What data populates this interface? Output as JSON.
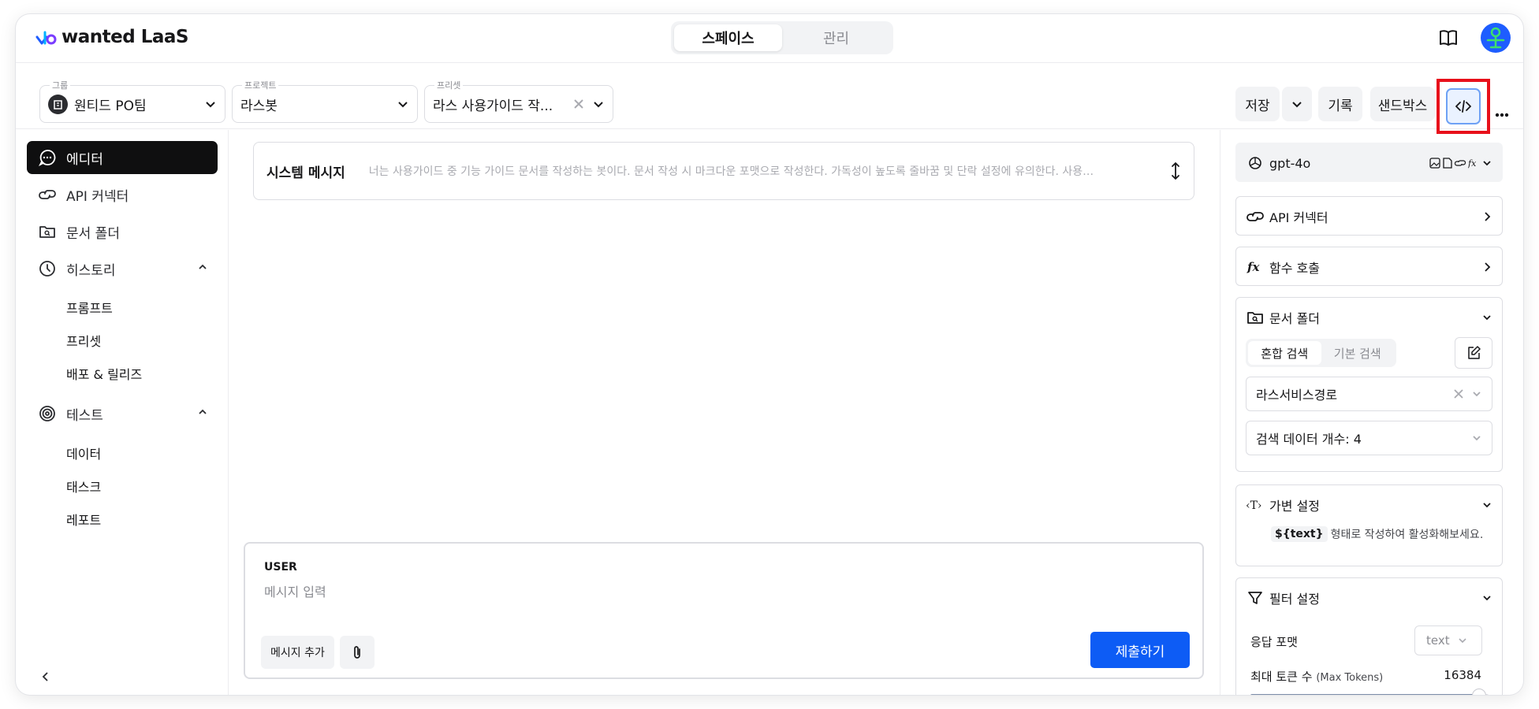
{
  "app": {
    "logo_text": "wanted LaaS"
  },
  "header": {
    "tabs": [
      {
        "label": "스페이스",
        "active": true
      },
      {
        "label": "관리",
        "active": false
      }
    ]
  },
  "toolbar": {
    "group": {
      "caption": "그룹",
      "value": "원티드 PO팀"
    },
    "project": {
      "caption": "프로젝트",
      "value": "라스봇"
    },
    "preset": {
      "caption": "프리셋",
      "value": "라스 사용가이드 작..."
    },
    "save_label": "저장",
    "history_label": "기록",
    "sandbox_label": "샌드박스",
    "more_label": "···"
  },
  "sidebar": {
    "items": [
      {
        "label": "에디터",
        "icon": "chat-icon",
        "active": true
      },
      {
        "label": "API 커넥터",
        "icon": "link-icon"
      },
      {
        "label": "문서 폴더",
        "icon": "folder-search-icon"
      },
      {
        "label": "히스토리",
        "icon": "clock-icon",
        "expanded": true
      },
      {
        "label": "테스트",
        "icon": "target-icon",
        "expanded": true
      }
    ],
    "history_sub": [
      "프롬프트",
      "프리셋",
      "배포 & 릴리즈"
    ],
    "test_sub": [
      "데이터",
      "태스크",
      "레포트"
    ]
  },
  "editor": {
    "system": {
      "title": "시스템 메시지",
      "text": "너는 사용가이드 중 기능 가이드 문서를 작성하는 봇이다. 문서 작성 시 마크다운 포맷으로 작성한다. 가독성이 높도록 줄바꿈 및 단락 설정에 유의한다. 사용가이..."
    },
    "composer": {
      "role": "USER",
      "placeholder": "메시지 입력",
      "add_label": "메시지 추가",
      "submit_label": "제출하기"
    }
  },
  "panel": {
    "model": "gpt-4o",
    "api_connector": "API 커넥터",
    "function_call": "함수 호출",
    "docs": {
      "title": "문서 폴더",
      "tabs": [
        "혼합 검색",
        "기본 검색"
      ],
      "folder": "라스서비스경로",
      "count_label": "검색 데이터 개수: 4"
    },
    "vars": {
      "title": "가변 설정",
      "chip": "${text}",
      "hint": "형태로 작성하여 활성화해보세요."
    },
    "filter": {
      "title": "필터 설정",
      "format_label": "응답 포맷",
      "format_value": "text",
      "tokens_label": "최대 토큰 수",
      "tokens_sub": "(Max Tokens)",
      "tokens_value": "16384",
      "tokens_fill": 0.96
    }
  },
  "colors": {
    "accent": "#0d5cf5",
    "highlight": "#e8101b",
    "active_nav": "#0f0f10"
  }
}
